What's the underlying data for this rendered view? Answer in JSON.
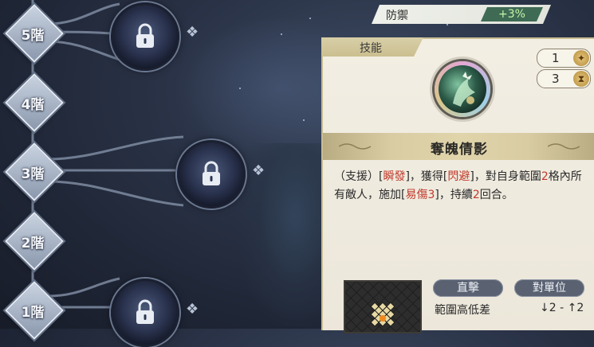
{
  "tree": {
    "tiers": [
      "5階",
      "4階",
      "3階",
      "2階",
      "1階"
    ]
  },
  "stat": {
    "name": "防禦",
    "value": "+3%"
  },
  "panel": {
    "tab": "技能",
    "cost": "1",
    "cooldown": "3",
    "skill_name": "奪魄倩影",
    "desc": {
      "t1": "（支援）[",
      "h1": "瞬發",
      "t2": "]，獲得[",
      "h2": "閃避",
      "t3": "]，對自身範圍",
      "n1": "2",
      "t4": "格內所有敵人，施加[",
      "h3": "易傷3",
      "t5": "]，持續",
      "n2": "2",
      "t6": "回合。"
    },
    "tag_attack": "直擊",
    "tag_target": "對單位",
    "range_label": "範圍高低差",
    "range_value": "↓2 - ↑2"
  },
  "colors": {
    "highlight": "#c0392b",
    "stat_green": "#3f6b55"
  }
}
